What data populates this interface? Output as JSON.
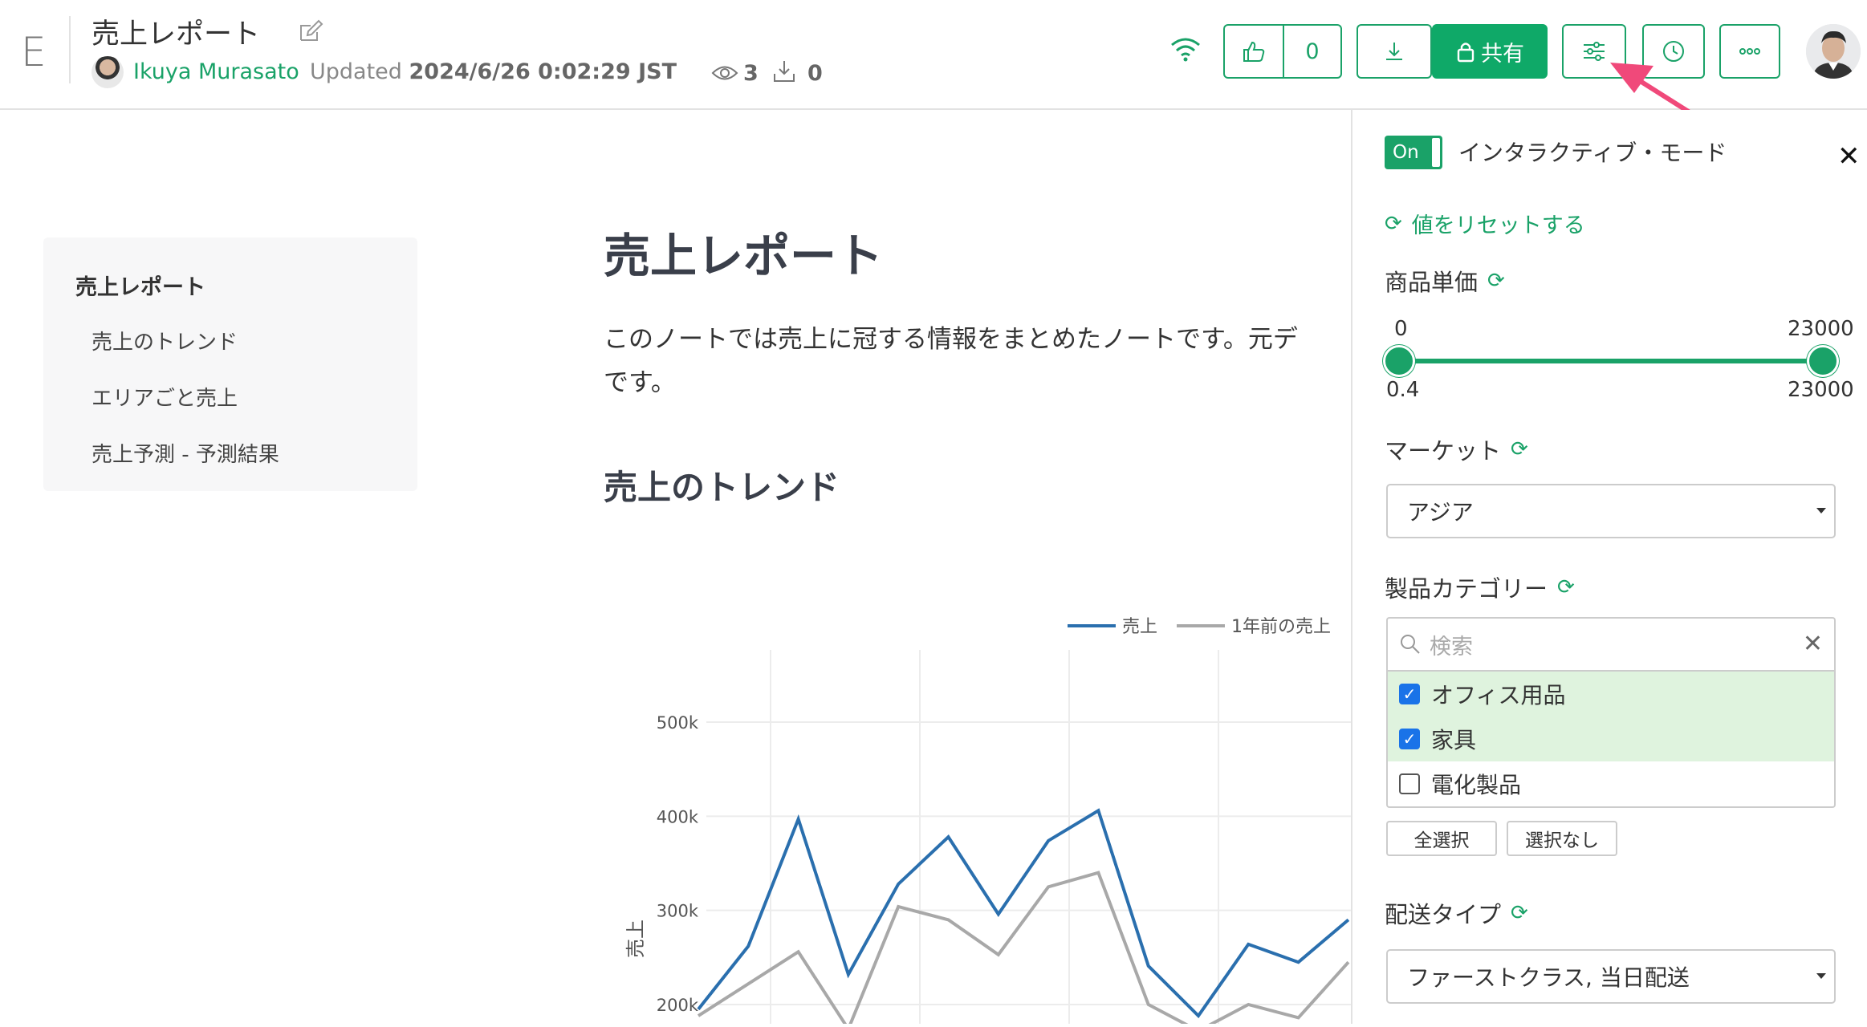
{
  "header": {
    "logo": "E",
    "title": "売上レポート",
    "author": "Ikuya Murasato",
    "updated_prefix": "Updated",
    "updated_time": "2024/6/26 0:02:29 JST",
    "views": "3",
    "downloads": "0",
    "like_count": "0",
    "share_label": "共有"
  },
  "toc": {
    "title": "売上レポート",
    "items": [
      "売上のトレンド",
      "エリアごと売上",
      "売上予測 - 予測結果"
    ]
  },
  "main": {
    "h1": "売上レポート",
    "paragraph_line1": "このノートでは売上に冠する情報をまとめたノートです。元デ",
    "paragraph_line2": "です。",
    "h2": "売上のトレンド"
  },
  "chart_data": {
    "type": "line",
    "ylabel": "売上",
    "y_ticks": [
      "200k",
      "300k",
      "400k",
      "500k"
    ],
    "ylim": [
      200000,
      500000
    ],
    "series": [
      {
        "name": "売上",
        "color": "#2a6fae",
        "values": [
          195000,
          262000,
          397000,
          232000,
          328000,
          378000,
          296000,
          374000,
          406000,
          241000,
          188000,
          264000,
          245000,
          290000
        ]
      },
      {
        "name": "1年前の売上",
        "color": "#a8a8a8",
        "values": [
          188000,
          222000,
          256000,
          174000,
          304000,
          290000,
          253000,
          325000,
          340000,
          200000,
          172000,
          200000,
          186000,
          245000
        ]
      }
    ]
  },
  "panel": {
    "toggle_label": "On",
    "mode_label": "インタラクティブ・モード",
    "reset_label": "値をリセットする",
    "price": {
      "label": "商品単価",
      "min_top": "0",
      "max_top": "23000",
      "min_bottom": "0.4",
      "max_bottom": "23000"
    },
    "market": {
      "label": "マーケット",
      "value": "アジア"
    },
    "category": {
      "label": "製品カテゴリー",
      "search_placeholder": "検索",
      "options": [
        {
          "label": "オフィス用品",
          "checked": true
        },
        {
          "label": "家具",
          "checked": true
        },
        {
          "label": "電化製品",
          "checked": false
        }
      ],
      "select_all": "全選択",
      "select_none": "選択なし"
    },
    "shipping": {
      "label": "配送タイプ",
      "value": "ファーストクラス, 当日配送"
    }
  },
  "colors": {
    "accent": "#1aa268",
    "arrow": "#f0497a"
  }
}
